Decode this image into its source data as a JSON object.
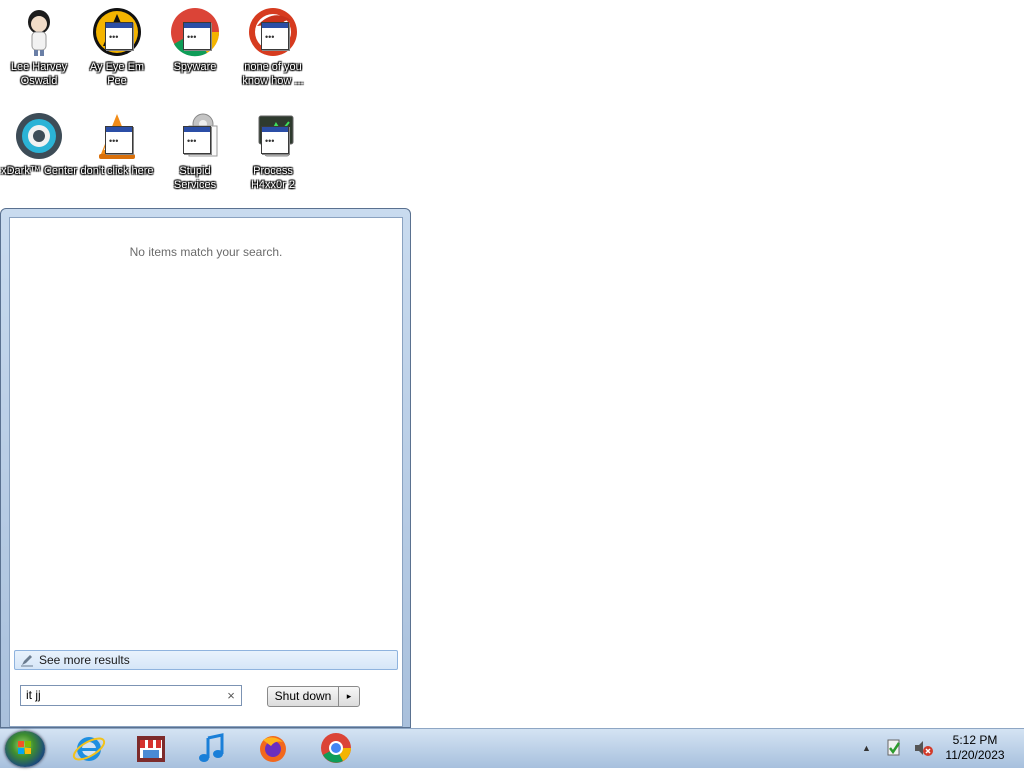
{
  "desktop": {
    "icons": [
      {
        "label": "Lee Harvey Oswald",
        "icon": "anime-character-icon"
      },
      {
        "label": "Ay Eye Em Pee",
        "icon": "aim-shortcut-icon"
      },
      {
        "label": "Spyware",
        "icon": "chrome-shortcut-icon"
      },
      {
        "label": "none of you know how ...",
        "icon": "red-bird-shortcut-icon"
      },
      {
        "label": "xDark™ Center",
        "icon": "ring-app-icon"
      },
      {
        "label": "don't click here",
        "icon": "vlc-shortcut-icon"
      },
      {
        "label": "Stupid Services",
        "icon": "services-shortcut-icon"
      },
      {
        "label": "Process H4xx0r 2",
        "icon": "process-hacker-shortcut-icon"
      }
    ]
  },
  "start_menu": {
    "no_results_text": "No items match your search.",
    "see_more_label": "See more results",
    "search_value": "it jj",
    "search_clear_glyph": "×",
    "shutdown_label": "Shut down",
    "shutdown_arrow_glyph": "▸"
  },
  "taskbar": {
    "pinned": [
      {
        "name": "internet-explorer-icon"
      },
      {
        "name": "store-app-icon"
      },
      {
        "name": "itunes-icon"
      },
      {
        "name": "firefox-icon"
      },
      {
        "name": "chrome-icon"
      }
    ],
    "tray": {
      "overflow_glyph": "▲",
      "time": "5:12 PM",
      "date": "11/20/2023"
    }
  }
}
